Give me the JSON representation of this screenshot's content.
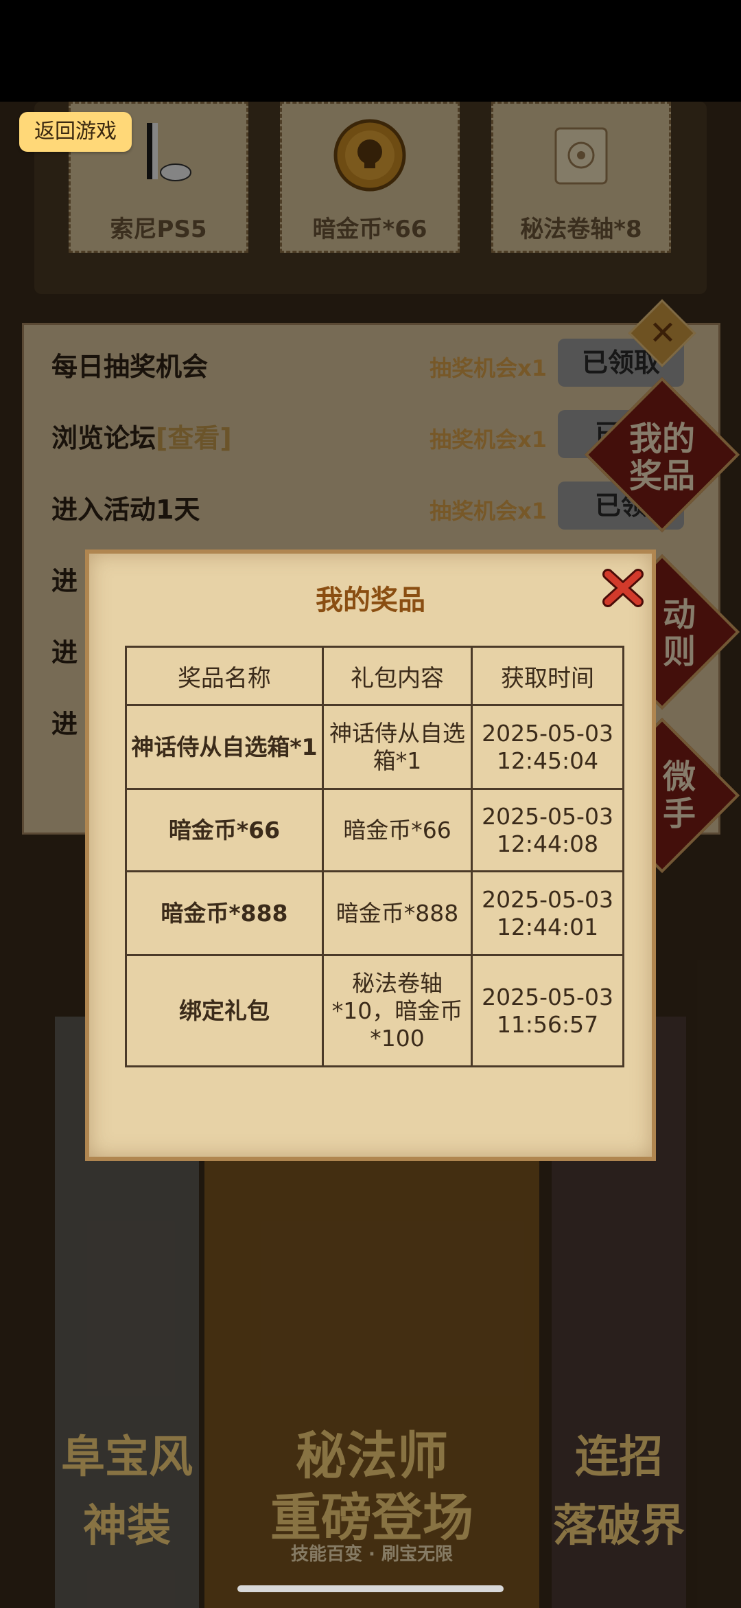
{
  "back_button": "返回游戏",
  "prizes": [
    {
      "label": "索尼PS5",
      "icon": "ps5-console-icon"
    },
    {
      "label": "暗金币*66",
      "icon": "skull-coin-icon"
    },
    {
      "label": "秘法卷轴*8",
      "icon": "scroll-icon"
    }
  ],
  "tasks": [
    {
      "name": "每日抽奖机会",
      "link": "",
      "reward": "抽奖机会x1",
      "button": "已领取"
    },
    {
      "name": "浏览论坛",
      "link": "[查看]",
      "reward": "抽奖机会x1",
      "button": "已领"
    },
    {
      "name": "进入活动1天",
      "link": "",
      "reward": "抽奖机会x1",
      "button": "已领"
    },
    {
      "name": "进",
      "link": "",
      "reward": "",
      "button": ""
    },
    {
      "name": "进",
      "link": "",
      "reward": "",
      "button": ""
    },
    {
      "name": "进",
      "link": "",
      "reward": "",
      "button": ""
    }
  ],
  "side_buttons": {
    "my_prizes": [
      "我的",
      "奖品"
    ],
    "rules": [
      "动",
      "则"
    ],
    "helper": [
      "微",
      "手"
    ]
  },
  "promo": {
    "center_title_1": "秘法师",
    "center_title_2": "重磅登场",
    "center_subtitle": "技能百变 · 刷宝无限",
    "left_text_1": "阜宝风",
    "left_text_2": "神装",
    "right_text_1": "连招",
    "right_text_2": "落破界"
  },
  "modal": {
    "title": "我的奖品",
    "headers": [
      "奖品名称",
      "礼包内容",
      "获取时间"
    ],
    "rows": [
      {
        "name": "神话侍从自选箱*1",
        "content": "神话侍从自选箱*1",
        "date": "2025-05-03",
        "time": "12:45:04"
      },
      {
        "name": "暗金币*66",
        "content": "暗金币*66",
        "date": "2025-05-03",
        "time": "12:44:08"
      },
      {
        "name": "暗金币*888",
        "content": "暗金币*888",
        "date": "2025-05-03",
        "time": "12:44:01"
      },
      {
        "name": "绑定礼包",
        "content": "秘法卷轴*10，暗金币*100",
        "date": "2025-05-03",
        "time": "11:56:57"
      }
    ]
  },
  "colors": {
    "accent_title": "#8a4e12",
    "close_red": "#c42a1e",
    "button_yellow": "#ffd878"
  }
}
